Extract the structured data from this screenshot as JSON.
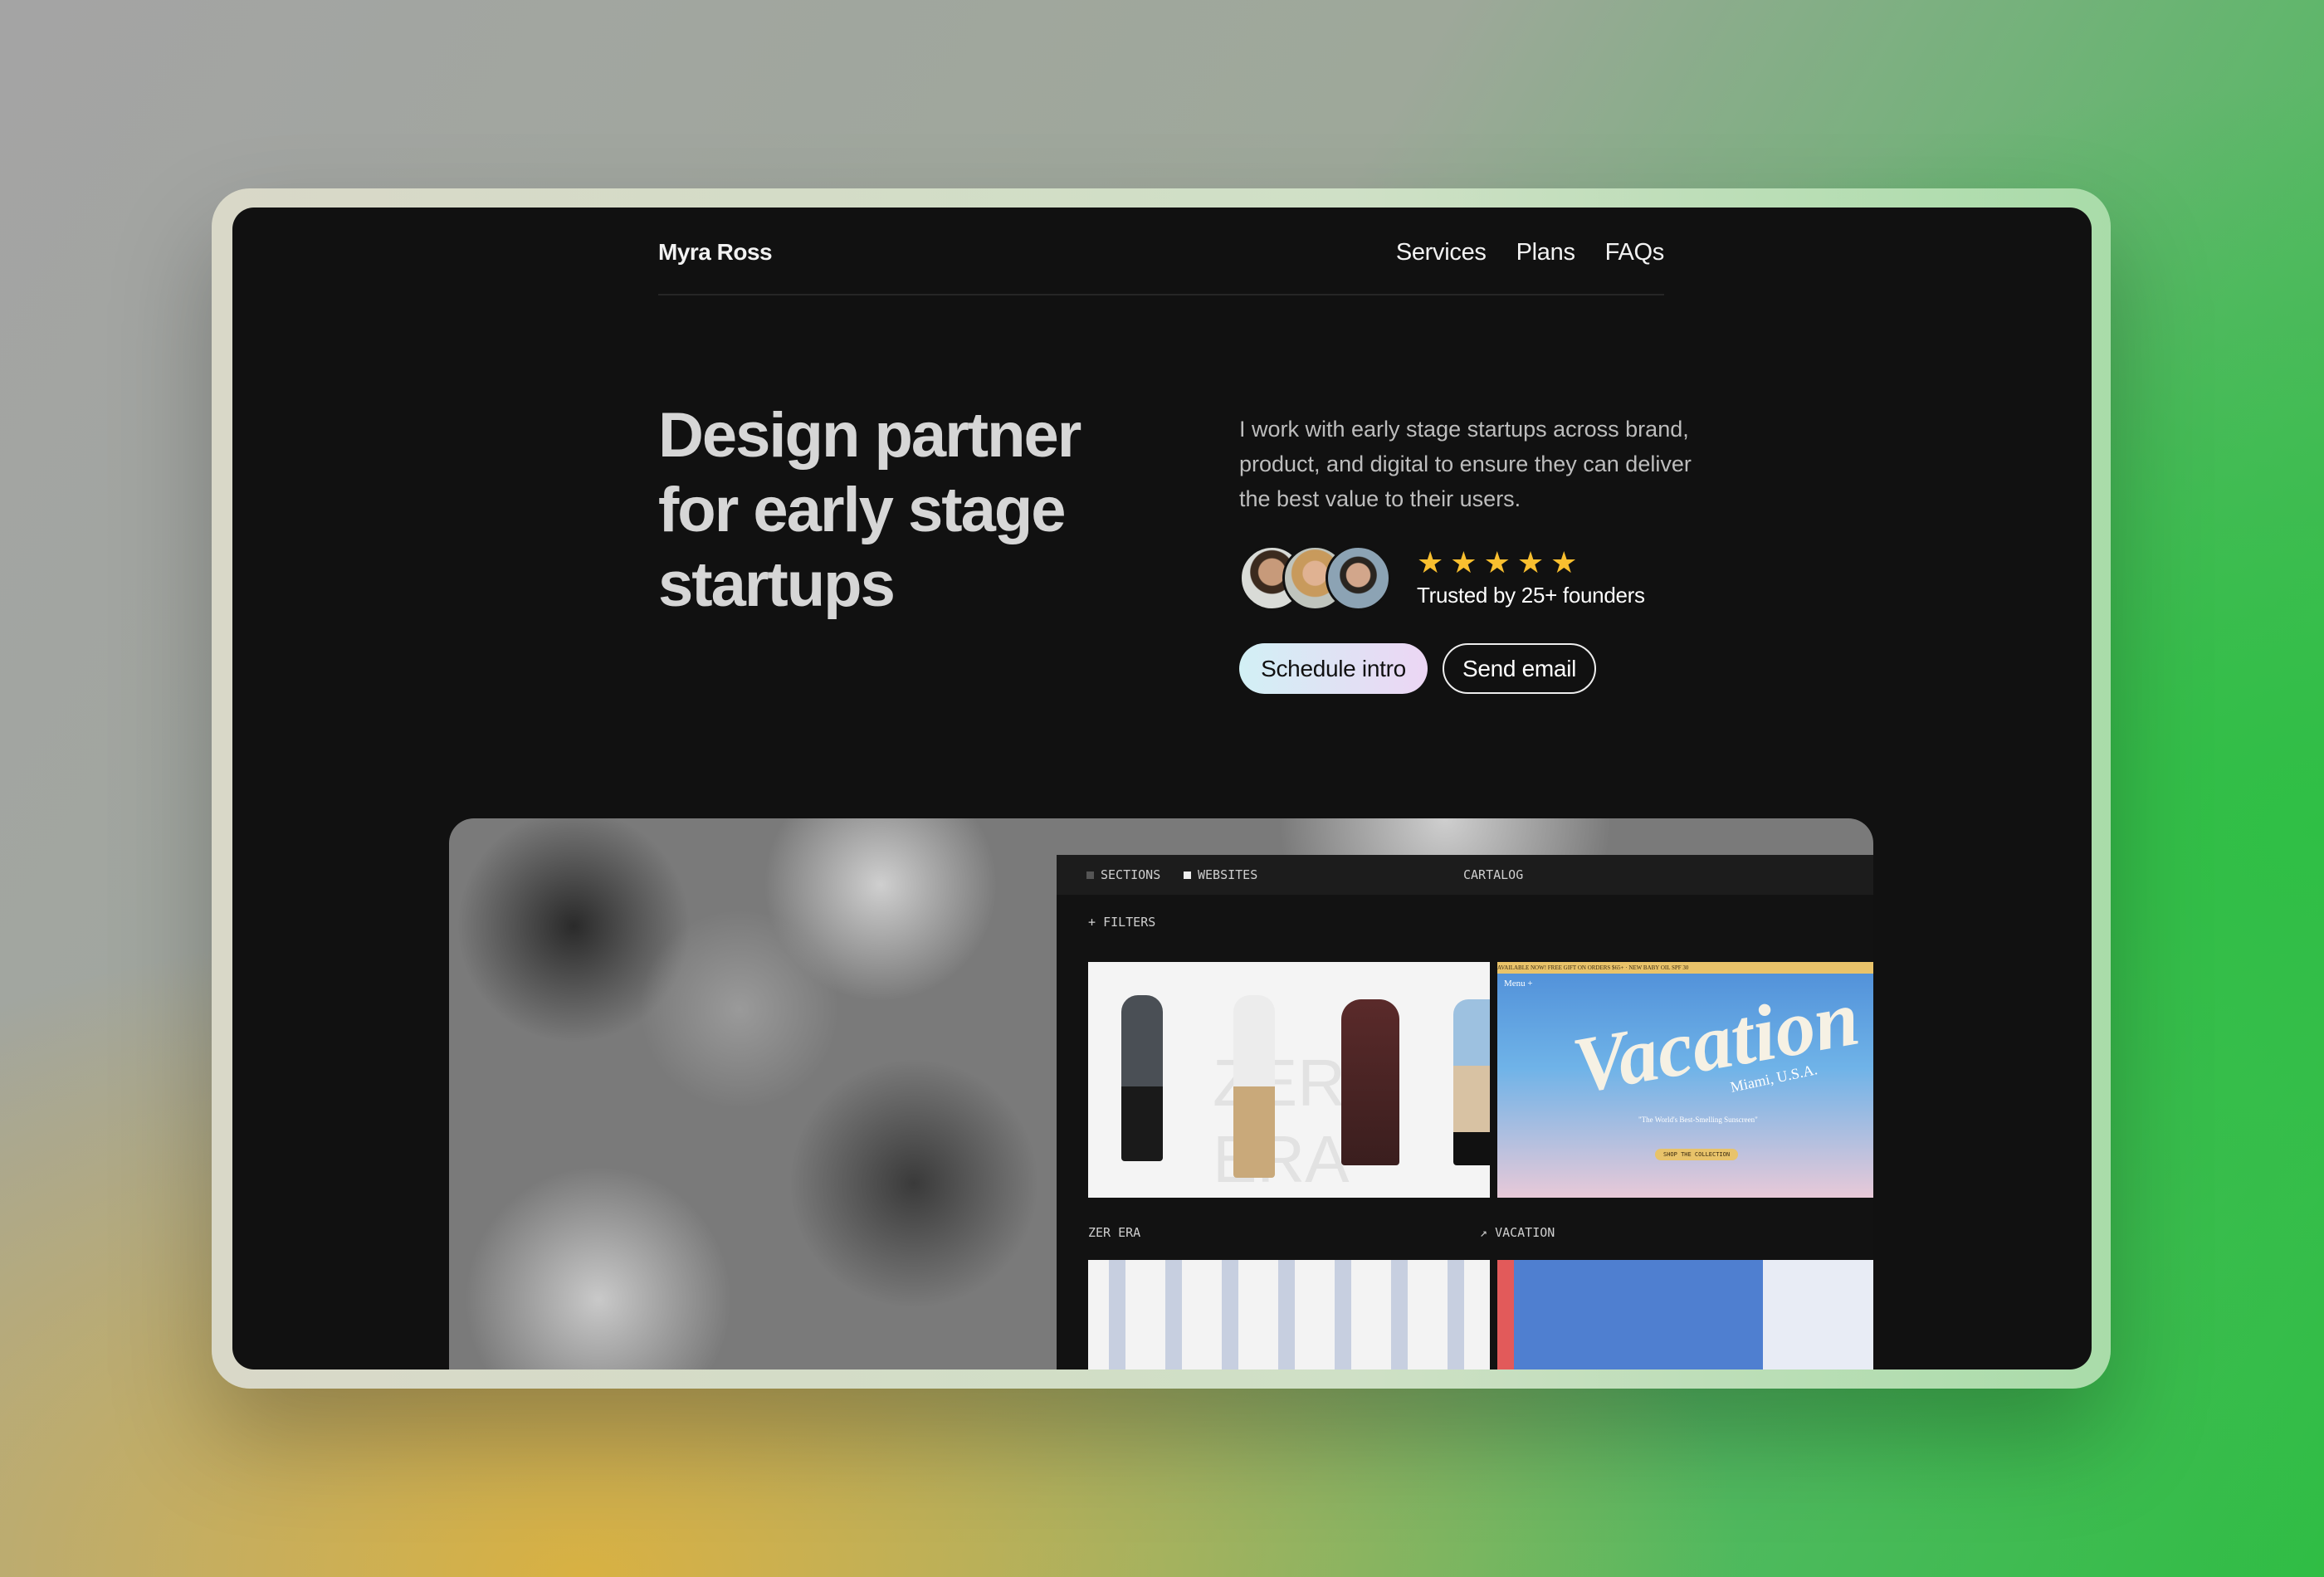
{
  "header": {
    "logo": "Myra Ross",
    "nav": [
      "Services",
      "Plans",
      "FAQs"
    ]
  },
  "hero": {
    "headline": "Design partner for early stage startups",
    "description": "I work with early stage startups across brand, product, and digital to ensure they can deliver the best value to their users.",
    "rating": {
      "stars": 5,
      "star_icon": "★",
      "star_color": "#f9bf2f"
    },
    "trusted": "Trusted by 25+ founders",
    "buttons": {
      "primary": "Schedule intro",
      "secondary": "Send email"
    }
  },
  "showcase": {
    "app": {
      "tabs": [
        "SECTIONS",
        "WEBSITES"
      ],
      "title": "CARTALOG",
      "filters": "FILTERS",
      "filters_icon": "+",
      "items": [
        {
          "label": "ZER ERA"
        },
        {
          "label": "VACATION",
          "icon": "↗"
        }
      ],
      "vacation_image": {
        "wordmark": "Vacation",
        "location": "Miami, U.S.A.",
        "tagline": "\"The World's Best-Smelling Sunscreen\"",
        "cta": "SHOP THE COLLECTION",
        "banner": "AVAILABLE NOW! FREE GIFT ON ORDERS $65+ · NEW BABY OIL SPF 30",
        "menu": "Menu +"
      },
      "zer_era_image": {
        "watermark": "ZER ERA"
      }
    }
  }
}
